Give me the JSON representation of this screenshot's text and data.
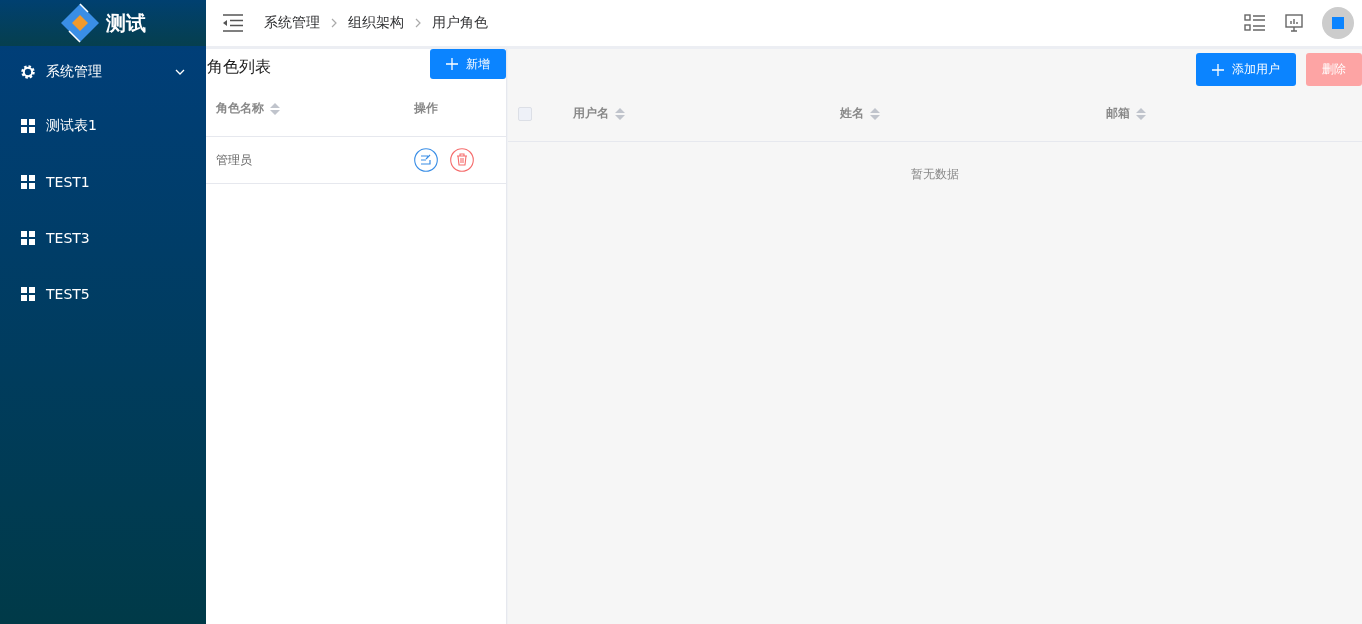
{
  "logo": {
    "title": "测试"
  },
  "sidebar": {
    "items": [
      {
        "kind": "group",
        "label": "系统管理",
        "expanded": true
      },
      {
        "kind": "link",
        "label": "测试表1"
      },
      {
        "kind": "link",
        "label": "TEST1"
      },
      {
        "kind": "link",
        "label": "TEST3"
      },
      {
        "kind": "link",
        "label": "TEST5"
      }
    ]
  },
  "breadcrumb": [
    "系统管理",
    "组织架构",
    "用户角色"
  ],
  "role_panel": {
    "title": "角色列表",
    "add_button": "新增",
    "columns": [
      {
        "label": "角色名称",
        "sortable": true
      },
      {
        "label": "操作",
        "sortable": false
      }
    ],
    "rows": [
      {
        "name": "管理员"
      }
    ]
  },
  "user_panel": {
    "add_button": "添加用户",
    "delete_button": {
      "label": "删除",
      "disabled": true
    },
    "select_all": {
      "checked": false
    },
    "columns": [
      {
        "label": "用户名",
        "sortable": true
      },
      {
        "label": "姓名",
        "sortable": true
      },
      {
        "label": "邮箱",
        "sortable": true
      }
    ],
    "empty_text": "暂无数据"
  }
}
